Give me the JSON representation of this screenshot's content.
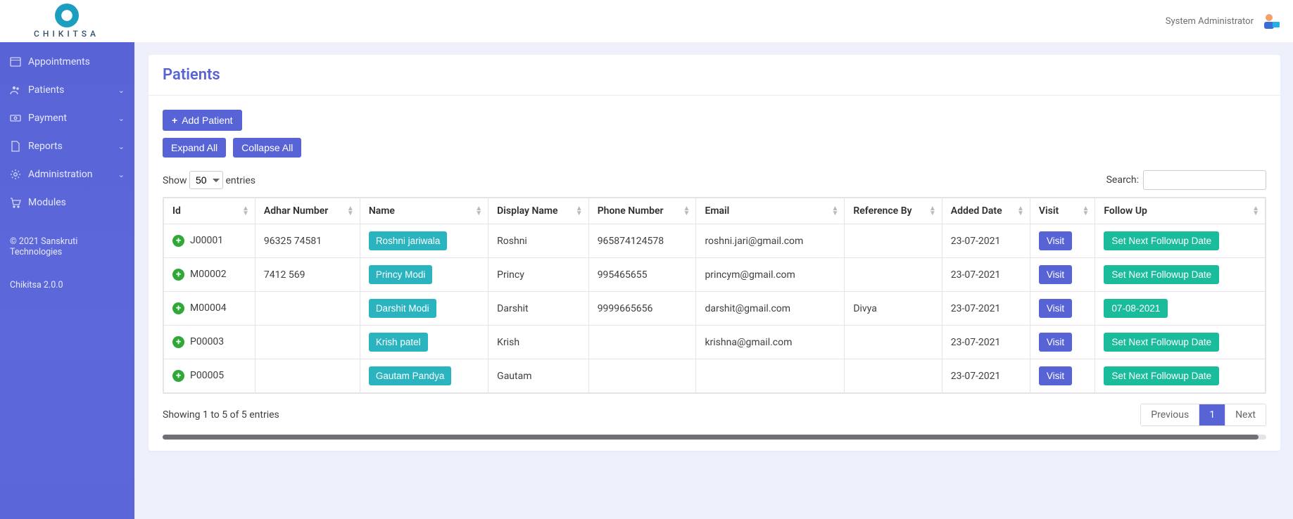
{
  "brand": {
    "name": "CHIKITSA"
  },
  "topbar": {
    "user_label": "System Administrator"
  },
  "sidebar": {
    "items": [
      {
        "label": "Appointments",
        "icon": "calendar-icon",
        "expandable": false
      },
      {
        "label": "Patients",
        "icon": "users-icon",
        "expandable": true
      },
      {
        "label": "Payment",
        "icon": "cash-icon",
        "expandable": true
      },
      {
        "label": "Reports",
        "icon": "document-icon",
        "expandable": true
      },
      {
        "label": "Administration",
        "icon": "gear-icon",
        "expandable": true
      },
      {
        "label": "Modules",
        "icon": "cart-icon",
        "expandable": false
      }
    ],
    "copyright": "© 2021 Sanskruti Technologies",
    "version": "Chikitsa 2.0.0"
  },
  "page": {
    "title": "Patients",
    "add_button": "Add Patient",
    "expand_all": "Expand All",
    "collapse_all": "Collapse All",
    "show_label_pre": "Show",
    "show_label_post": "entries",
    "show_value": "50",
    "search_label": "Search:",
    "columns": [
      "Id",
      "Adhar Number",
      "Name",
      "Display Name",
      "Phone Number",
      "Email",
      "Reference By",
      "Added Date",
      "Visit",
      "Follow Up"
    ],
    "rows": [
      {
        "id": "J00001",
        "adhar": "96325 74581",
        "name": "Roshni jariwala",
        "display": "Roshni",
        "phone": "965874124578",
        "email": "roshni.jari@gmail.com",
        "ref": "",
        "added": "23-07-2021",
        "visit": "Visit",
        "followup": "Set Next Followup Date"
      },
      {
        "id": "M00002",
        "adhar": "7412 569",
        "name": "Princy Modi",
        "display": "Princy",
        "phone": "995465655",
        "email": "princym@gmail.com",
        "ref": "",
        "added": "23-07-2021",
        "visit": "Visit",
        "followup": "Set Next Followup Date"
      },
      {
        "id": "M00004",
        "adhar": "",
        "name": "Darshit Modi",
        "display": "Darshit",
        "phone": "9999665656",
        "email": "darshit@gmail.com",
        "ref": "Divya",
        "added": "23-07-2021",
        "visit": "Visit",
        "followup": "07-08-2021"
      },
      {
        "id": "P00003",
        "adhar": "",
        "name": "Krish patel",
        "display": "Krish",
        "phone": "",
        "email": "krishna@gmail.com",
        "ref": "",
        "added": "23-07-2021",
        "visit": "Visit",
        "followup": "Set Next Followup Date"
      },
      {
        "id": "P00005",
        "adhar": "",
        "name": "Gautam Pandya",
        "display": "Gautam",
        "phone": "",
        "email": "",
        "ref": "",
        "added": "23-07-2021",
        "visit": "Visit",
        "followup": "Set Next Followup Date"
      }
    ],
    "footer_info": "Showing 1 to 5 of 5 entries",
    "pager": {
      "prev": "Previous",
      "pages": [
        "1"
      ],
      "next": "Next",
      "active": "1"
    }
  }
}
